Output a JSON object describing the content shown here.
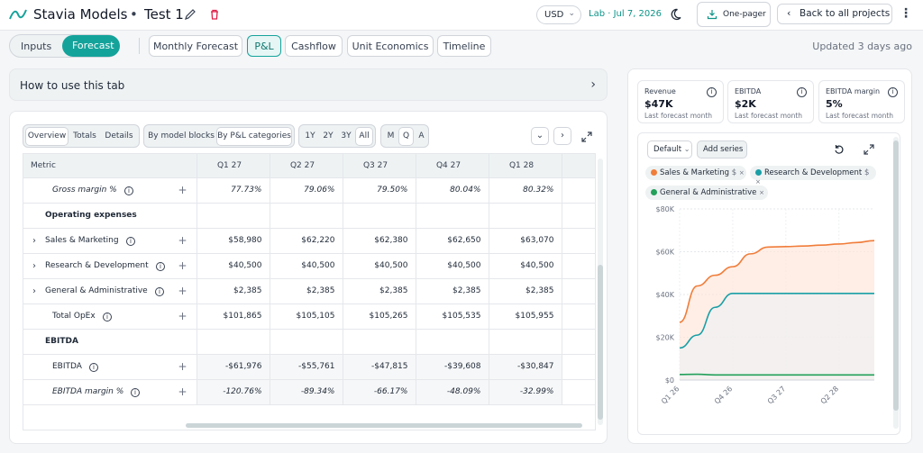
{
  "header": {
    "app_title": "Stavia Models",
    "separator": "•",
    "project_name": "Test 1",
    "currency": "USD",
    "lab_label": "Lab · Jul 7, 2026",
    "one_pager_label": "One-pager",
    "back_label": "Back to all projects"
  },
  "mode": {
    "inputs_label": "Inputs",
    "forecast_label": "Forecast",
    "active": "Forecast"
  },
  "tabs": [
    {
      "label": "Monthly Forecast"
    },
    {
      "label": "P&L"
    },
    {
      "label": "Cashflow"
    },
    {
      "label": "Unit Economics"
    },
    {
      "label": "Timeline"
    }
  ],
  "active_tab": "P&L",
  "updated_text": "Updated 3 days ago",
  "howto": {
    "title": "How to use this tab"
  },
  "controls": {
    "view": [
      "Overview",
      "Totals",
      "Details"
    ],
    "grouping": [
      "By model blocks",
      "By P&L categories"
    ],
    "range": [
      "1Y",
      "2Y",
      "3Y",
      "All"
    ],
    "period": [
      "M",
      "Q",
      "A"
    ]
  },
  "table": {
    "metric_header": "Metric",
    "columns": [
      "Q1 27",
      "Q2 27",
      "Q3 27",
      "Q4 27",
      "Q1 28"
    ],
    "rows": [
      {
        "label": "Gross margin %",
        "values": [
          "77.73%",
          "79.06%",
          "79.50%",
          "80.04%",
          "80.32%"
        ]
      },
      {
        "label": "Operating expenses",
        "values": []
      },
      {
        "label": "Sales & Marketing",
        "values": [
          "$58,980",
          "$62,220",
          "$62,380",
          "$62,650",
          "$63,070"
        ]
      },
      {
        "label": "Research & Development",
        "values": [
          "$40,500",
          "$40,500",
          "$40,500",
          "$40,500",
          "$40,500"
        ]
      },
      {
        "label": "General & Administrative",
        "values": [
          "$2,385",
          "$2,385",
          "$2,385",
          "$2,385",
          "$2,385"
        ]
      },
      {
        "label": "Total OpEx",
        "values": [
          "$101,865",
          "$105,105",
          "$105,265",
          "$105,535",
          "$105,955"
        ]
      },
      {
        "label": "EBITDA",
        "values": []
      },
      {
        "label": "EBITDA",
        "values": [
          "-$61,976",
          "-$55,761",
          "-$47,815",
          "-$39,608",
          "-$30,847"
        ]
      },
      {
        "label": "EBITDA margin %",
        "values": [
          "-120.76%",
          "-89.34%",
          "-66.17%",
          "-48.09%",
          "-32.99%"
        ]
      }
    ]
  },
  "kpis": [
    {
      "label": "Revenue",
      "value": "$47K",
      "sub": "Last forecast month"
    },
    {
      "label": "EBITDA",
      "value": "$2K",
      "sub": "Last forecast month"
    },
    {
      "label": "EBITDA margin",
      "value": "5%",
      "sub": "Last forecast month"
    }
  ],
  "chart_controls": {
    "default_label": "Default",
    "add_series_label": "Add series"
  },
  "series_chips": [
    {
      "name": "Sales & Marketing",
      "unit": "$",
      "color": "#f07d3a"
    },
    {
      "name": "Research & Development",
      "unit": "$",
      "color": "#1a9fa6"
    },
    {
      "name": "General & Administrative",
      "color": "#22a05a"
    }
  ],
  "chart_data": {
    "type": "area",
    "y_ticks": [
      "$80K",
      "$60K",
      "$40K",
      "$20K",
      "$0"
    ],
    "ylim": [
      0,
      80000
    ],
    "x_tick_labels": [
      "Q1 26",
      "Q4 26",
      "Q3 27",
      "Q2 28"
    ],
    "x": [
      "Q1 26",
      "Q2 26",
      "Q3 26",
      "Q4 26",
      "Q1 27",
      "Q2 27",
      "Q3 27",
      "Q4 27",
      "Q1 28",
      "Q2 28",
      "Q3 28",
      "Q4 28"
    ],
    "series": [
      {
        "name": "Sales & Marketing",
        "color": "#f07d3a",
        "fill": "#fde7dc",
        "values": [
          27000,
          44000,
          49000,
          53000,
          59000,
          62200,
          62400,
          62650,
          63070,
          63600,
          64300,
          65200
        ]
      },
      {
        "name": "Research & Development",
        "color": "#1a9fa6",
        "fill": "#eef1f2",
        "values": [
          15000,
          21000,
          34000,
          40500,
          40500,
          40500,
          40500,
          40500,
          40500,
          40500,
          40500,
          40500
        ]
      },
      {
        "name": "General & Administrative",
        "color": "#22a05a",
        "fill": "none",
        "values": [
          2600,
          2700,
          2400,
          2385,
          2385,
          2385,
          2385,
          2385,
          2385,
          2385,
          2385,
          2385
        ]
      }
    ],
    "grid": true
  }
}
